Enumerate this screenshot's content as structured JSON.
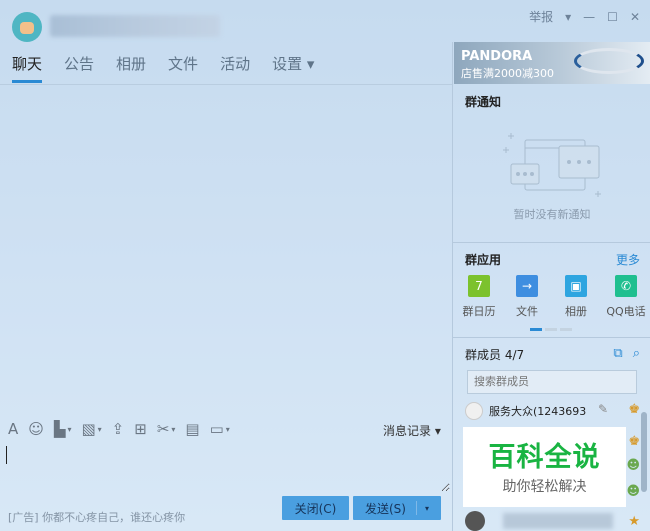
{
  "titlebar": {
    "report": "举报",
    "dropdown": "▾",
    "minimize": "—",
    "maximize": "☐",
    "close": "✕"
  },
  "tabs": [
    {
      "label": "聊天",
      "active": true
    },
    {
      "label": "公告"
    },
    {
      "label": "相册"
    },
    {
      "label": "文件"
    },
    {
      "label": "活动"
    },
    {
      "label": "设置 ▾"
    }
  ],
  "toolbar": {
    "history": "消息记录 ▾",
    "icons": [
      "font-icon",
      "emoji-icon",
      "gif-icon",
      "image-icon",
      "upload-icon",
      "gift-icon",
      "scissors-icon",
      "archive-icon",
      "screen-share-icon"
    ]
  },
  "input": {
    "value": ""
  },
  "footer": {
    "ad": "[广告] 你都不心疼自己，谁还心疼你",
    "close": "关闭(C)",
    "send": "发送(S)"
  },
  "banner": {
    "brand": "PANDORA",
    "promo": "店售满2000减300"
  },
  "notice": {
    "title": "群通知",
    "empty": "暂时没有新通知"
  },
  "apps": {
    "title": "群应用",
    "more": "更多",
    "items": [
      {
        "label": "群日历",
        "color": "#7cc22d",
        "glyph": "7"
      },
      {
        "label": "文件",
        "color": "#3e8ee0",
        "glyph": "→"
      },
      {
        "label": "相册",
        "color": "#2ea5e0",
        "glyph": "▣"
      },
      {
        "label": "QQ电话",
        "color": "#1fbf8f",
        "glyph": "✆"
      }
    ]
  },
  "members": {
    "title": "群成员 4/7",
    "search_placeholder": "搜索群成员",
    "list": [
      {
        "name": "服务大众(1243693"
      }
    ]
  },
  "watermark": {
    "title": "百科全说",
    "subtitle": "助你轻松解决"
  }
}
